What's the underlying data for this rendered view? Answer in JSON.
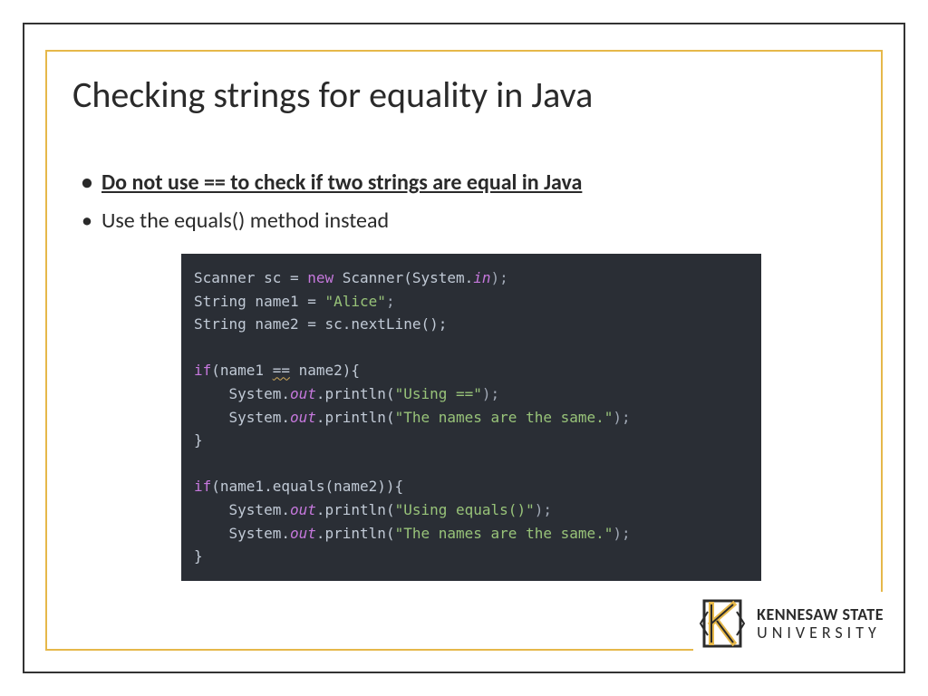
{
  "title": "Checking strings for equality in Java",
  "bullets": [
    {
      "text": "Do not use == to check if two strings are equal in Java",
      "emphasis": true
    },
    {
      "text": "Use the equals() method instead",
      "emphasis": false
    }
  ],
  "code": {
    "l1a": "Scanner sc = ",
    "l1b": "new",
    "l1c": " Scanner(System.",
    "l1d": "in",
    "l1e": ");",
    "l2a": "String name1 = ",
    "l2b": "\"Alice\"",
    "l2c": ";",
    "l3a": "String name2 = sc.nextLine();",
    "l5a": "if",
    "l5b": "(name1 ",
    "l5c": "==",
    "l5d": " name2){",
    "l6a": "    System.",
    "l6b": "out",
    "l6c": ".println(",
    "l6d": "\"Using ==\"",
    "l6e": ");",
    "l7a": "    System.",
    "l7b": "out",
    "l7c": ".println(",
    "l7d": "\"The names are the same.\"",
    "l7e": ");",
    "l8": "}",
    "l10a": "if",
    "l10b": "(name1.equals(name2)){",
    "l11a": "    System.",
    "l11b": "out",
    "l11c": ".println(",
    "l11d": "\"Using equals()\"",
    "l11e": ");",
    "l12a": "    System.",
    "l12b": "out",
    "l12c": ".println(",
    "l12d": "\"The names are the same.\"",
    "l12e": ");",
    "l13": "}"
  },
  "logo": {
    "line1": "KENNESAW STATE",
    "line2": "UNIVERSITY"
  }
}
